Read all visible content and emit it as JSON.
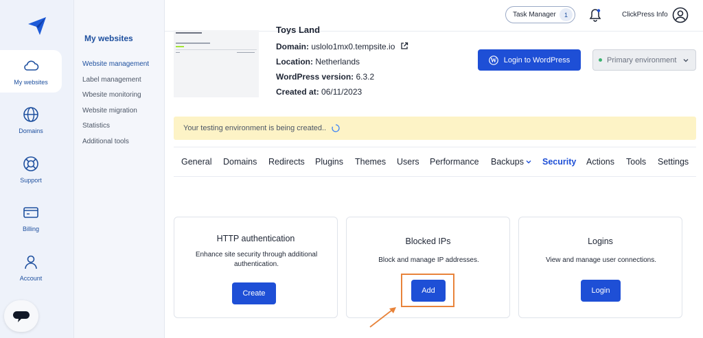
{
  "rail": {
    "items": [
      {
        "label": "My websites",
        "icon": "cloud-icon"
      },
      {
        "label": "Domains",
        "icon": "globe-icon"
      },
      {
        "label": "Support",
        "icon": "lifebuoy-icon"
      },
      {
        "label": "Billing",
        "icon": "card-icon"
      },
      {
        "label": "Account",
        "icon": "user-icon"
      }
    ]
  },
  "subnav": {
    "title": "My websites",
    "items": [
      "Website management",
      "Label management",
      "Wbesite monitoring",
      "Website migration",
      "Statistics",
      "Additional tools"
    ]
  },
  "topbar": {
    "task_manager": "Task Manager",
    "task_count": "1",
    "user_name": "ClickPress Info"
  },
  "site": {
    "name": "Toys Land",
    "domain_label": "Domain:",
    "domain_value": "uslolo1mx0.tempsite.io",
    "location_label": "Location:",
    "location_value": "Netherlands",
    "wp_label": "WordPress version:",
    "wp_value": "6.3.2",
    "created_label": "Created at:",
    "created_value": "06/11/2023",
    "login_wp": "Login to WordPress",
    "environment": "Primary environment"
  },
  "banner": {
    "text": "Your testing environment is being created.."
  },
  "tabs": [
    "General",
    "Domains",
    "Redirects",
    "Plugins",
    "Themes",
    "Users",
    "Performance",
    "Backups",
    "Security",
    "Actions",
    "Tools",
    "Settings"
  ],
  "active_tab": "Security",
  "cards": [
    {
      "title": "HTTP authentication",
      "desc": "Enhance site security through additional authentication.",
      "button": "Create"
    },
    {
      "title": "Blocked IPs",
      "desc": "Block and manage IP addresses.",
      "button": "Add"
    },
    {
      "title": "Logins",
      "desc": "View and manage user connections.",
      "button": "Login"
    }
  ],
  "colors": {
    "primary": "#1e4fd6",
    "nav_accent": "#1d4f9e",
    "banner_bg": "#fdf3c6",
    "highlight": "#e8833a"
  }
}
